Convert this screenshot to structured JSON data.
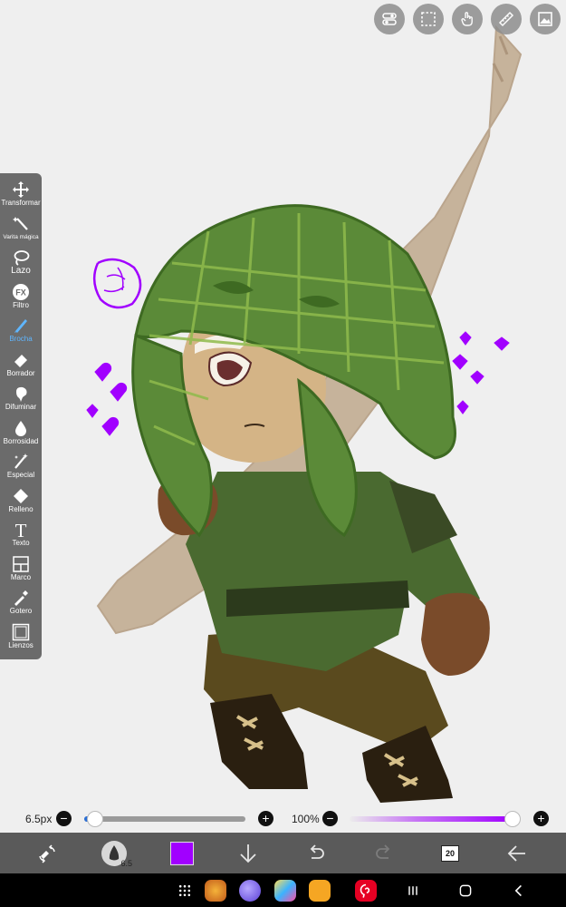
{
  "toolbar": {
    "items": [
      {
        "label": "Transformar",
        "icon": "move-icon"
      },
      {
        "label": "Varita mágica",
        "icon": "magic-wand-icon"
      },
      {
        "label": "Lazo",
        "icon": "lasso-icon"
      },
      {
        "label": "Filtro",
        "icon": "fx-icon"
      },
      {
        "label": "Brocha",
        "icon": "brush-icon",
        "active": true
      },
      {
        "label": "Borrador",
        "icon": "eraser-icon"
      },
      {
        "label": "Difuminar",
        "icon": "smudge-icon"
      },
      {
        "label": "Borrosidad",
        "icon": "blur-icon"
      },
      {
        "label": "Especial",
        "icon": "special-icon"
      },
      {
        "label": "Relleno",
        "icon": "fill-icon"
      },
      {
        "label": "Texto",
        "icon": "text-icon"
      },
      {
        "label": "Marco",
        "icon": "frame-icon"
      },
      {
        "label": "Gotero",
        "icon": "eyedropper-icon"
      },
      {
        "label": "Lienzos",
        "icon": "canvas-icon"
      }
    ],
    "fx_text": "FX",
    "text_glyph": "T"
  },
  "sliders": {
    "brush_size_label": "6.5px",
    "brush_size_fraction": 0.07,
    "opacity_label": "100%",
    "opacity_fraction": 1.0,
    "minus": "−",
    "plus": "+"
  },
  "action_bar": {
    "brush_preview_size": "6.5",
    "current_color": "#a100ff",
    "layer_count": "20"
  },
  "colors": {
    "accent": "#5fb6ff",
    "toolbar_bg": "#6b6b6b",
    "action_bar_bg": "#5a5a5a",
    "brush_color": "#a100ff"
  }
}
